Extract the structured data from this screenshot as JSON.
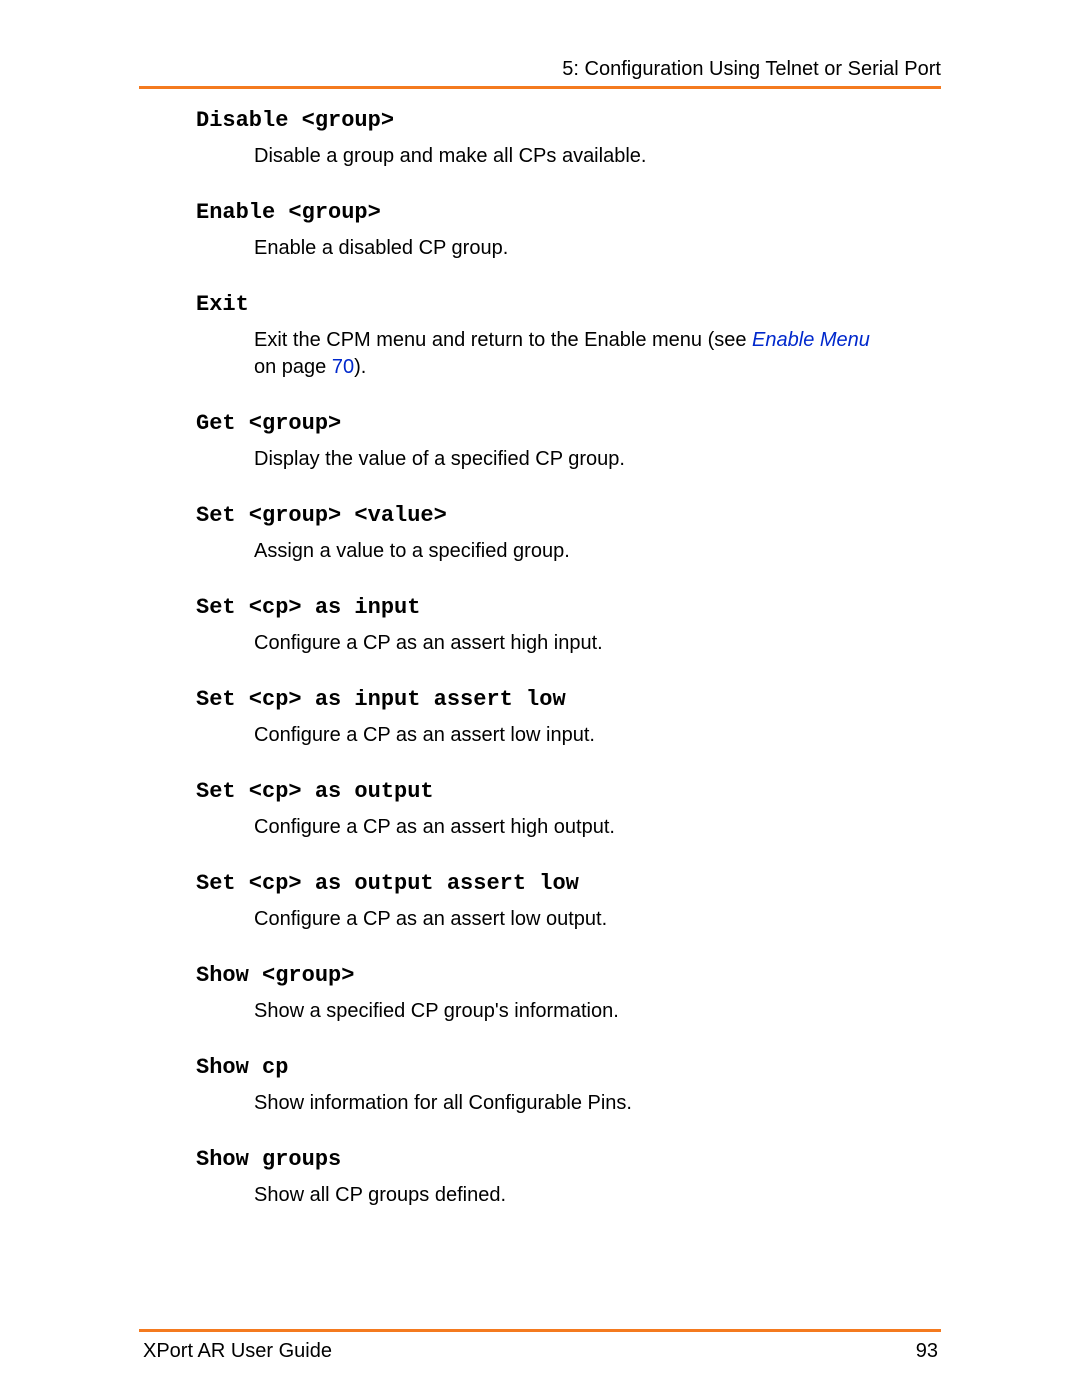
{
  "header": {
    "title": "5: Configuration Using Telnet or Serial Port"
  },
  "commands": [
    {
      "cmd": "Disable <group>",
      "desc": "Disable a group and make all CPs available."
    },
    {
      "cmd": "Enable <group>",
      "desc": "Enable a disabled CP group."
    },
    {
      "cmd": "Exit",
      "desc_pre": "Exit the CPM menu and return to the Enable menu (see ",
      "link_text": "Enable Menu",
      "desc_mid": " on page ",
      "link_page": "70",
      "desc_post": ")."
    },
    {
      "cmd": "Get <group>",
      "desc": "Display the value of a specified CP group."
    },
    {
      "cmd": "Set <group> <value>",
      "desc": "Assign a value to a specified group."
    },
    {
      "cmd": "Set <cp> as input",
      "desc": "Configure a CP as an assert high input."
    },
    {
      "cmd": "Set <cp> as input assert low",
      "desc": "Configure a CP as an assert low input."
    },
    {
      "cmd": "Set <cp> as output",
      "desc": "Configure a CP as an assert high output."
    },
    {
      "cmd": "Set <cp> as output assert low",
      "desc": "Configure a CP as an assert low output."
    },
    {
      "cmd": "Show <group>",
      "desc": "Show a specified CP group's information."
    },
    {
      "cmd": "Show cp",
      "desc": "Show information for all Configurable Pins."
    },
    {
      "cmd": "Show groups",
      "desc": "Show all CP groups defined."
    }
  ],
  "footer": {
    "guide": "XPort AR User Guide",
    "page": "93"
  }
}
